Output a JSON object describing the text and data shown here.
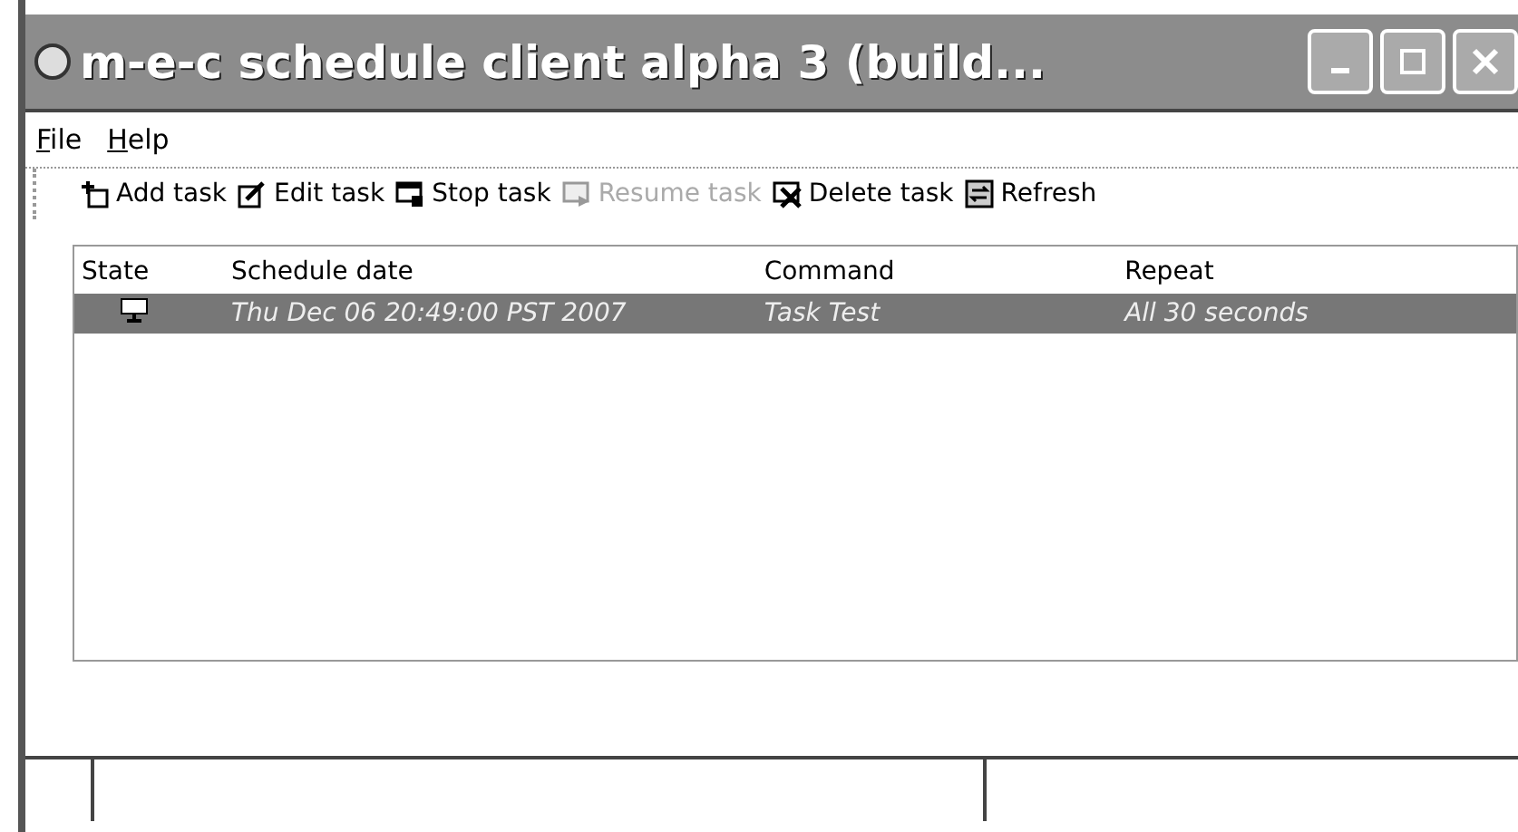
{
  "window": {
    "title": "m-e-c schedule client alpha 3 (build..."
  },
  "menu": [
    {
      "label": "File"
    },
    {
      "label": "Help"
    }
  ],
  "toolbar": [
    {
      "label": "Add task",
      "kind": "add",
      "disabled": false
    },
    {
      "label": "Edit task",
      "kind": "edit",
      "disabled": false
    },
    {
      "label": "Stop task",
      "kind": "stop",
      "disabled": false
    },
    {
      "label": "Resume task",
      "kind": "resume",
      "disabled": true
    },
    {
      "label": "Delete task",
      "kind": "delete",
      "disabled": false
    },
    {
      "label": "Refresh",
      "kind": "refresh",
      "disabled": false
    }
  ],
  "table": {
    "columns": [
      "State",
      "Schedule date",
      "Command",
      "Repeat"
    ],
    "rows": [
      {
        "selected": true,
        "schedule_date": "Thu Dec 06 20:49:00 PST 2007",
        "command": "Task Test",
        "repeat": "All 30 seconds"
      }
    ]
  }
}
